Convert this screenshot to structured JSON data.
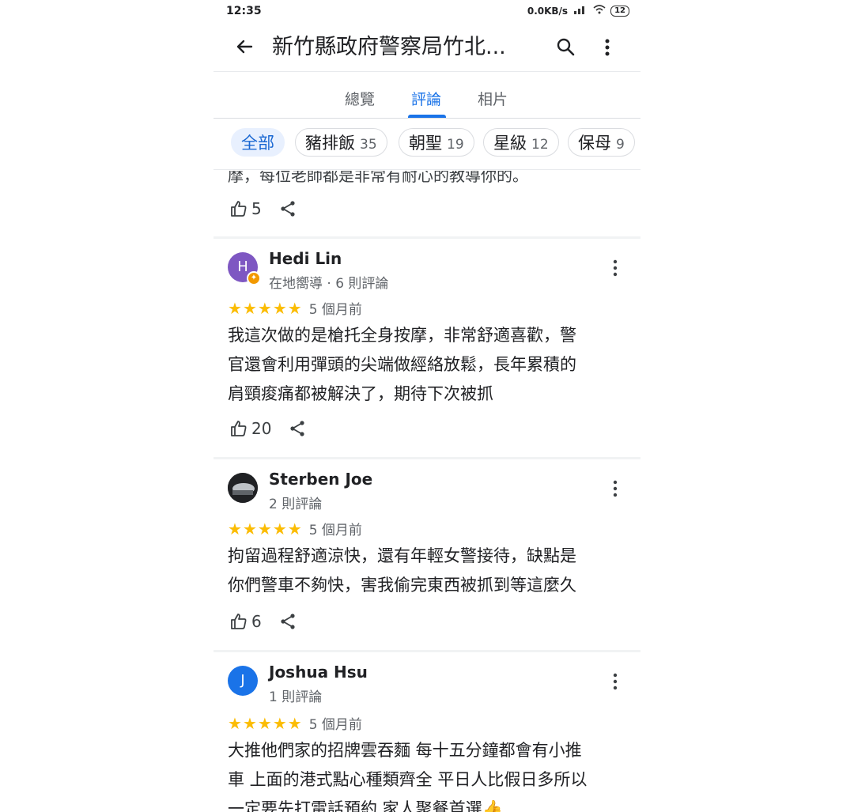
{
  "status_bar": {
    "time": "12:35",
    "net": "0.0KB/s",
    "battery": "12"
  },
  "app_bar": {
    "title": "新竹縣政府警察局竹北..."
  },
  "tabs": [
    {
      "label": "總覽"
    },
    {
      "label": "評論"
    },
    {
      "label": "相片"
    }
  ],
  "chips": [
    {
      "label": "全部",
      "count": ""
    },
    {
      "label": "豬排飯",
      "count": "35"
    },
    {
      "label": "朝聖",
      "count": "19"
    },
    {
      "label": "星級",
      "count": "12"
    },
    {
      "label": "保母",
      "count": "9"
    }
  ],
  "previous_review": {
    "partial_text": "摩，每位老師都是非常有耐心的教導你的。",
    "likes": "5"
  },
  "reviews": [
    {
      "name": "Hedi Lin",
      "initial": "H",
      "avatar_color": "#7e57c2",
      "meta": "在地嚮導 · 6 則評論",
      "date": "5 個月前",
      "lines": [
        "我這次做的是槍托全身按摩，非常舒適喜歡，警",
        "官還會利用彈頭的尖端做經絡放鬆，長年累積的",
        "肩頸痠痛都被解決了，期待下次被抓"
      ],
      "likes": "20"
    },
    {
      "name": "Sterben Joe",
      "initial": "",
      "avatar_color": "#3c4043",
      "meta": "2 則評論",
      "date": "5 個月前",
      "lines": [
        "拘留過程舒適涼快，還有年輕女警接待，缺點是",
        "你們警車不夠快，害我偷完東西被抓到等這麼久"
      ],
      "likes": "6"
    },
    {
      "name": "Joshua Hsu",
      "initial": "J",
      "avatar_color": "#1a73e8",
      "meta": "1 則評論",
      "date": "5 個月前",
      "lines": [
        "大推他們家的招牌雲吞麵 每十五分鐘都會有小推",
        "車 上面的港式點心種類齊全 平日人比假日多所以",
        "一定要先打電話預約 家人聚餐首選👍"
      ],
      "likes": ""
    }
  ],
  "colors": {
    "accent": "#1a73e8",
    "star": "#fbbc04"
  }
}
